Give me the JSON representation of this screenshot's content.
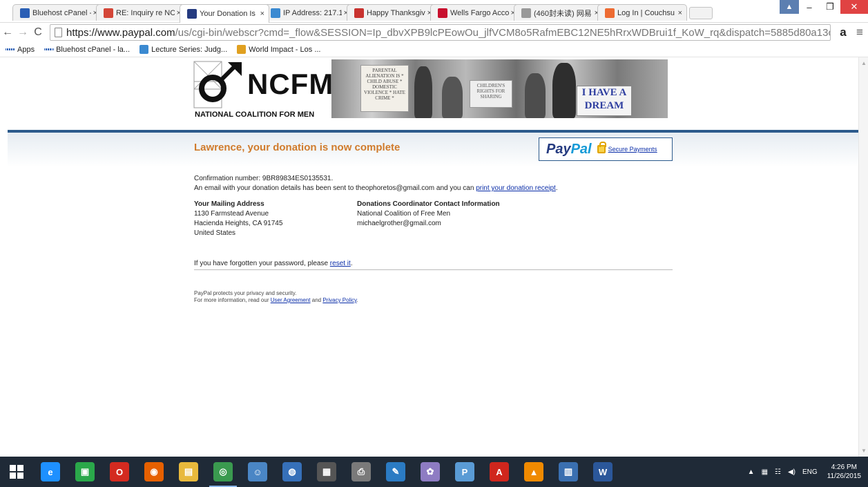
{
  "browser": {
    "tabs": [
      {
        "title": "Bluehost cPanel - ",
        "icon": "bluehost-grid-icon",
        "color": "#2b5fb5"
      },
      {
        "title": "RE: Inquiry re NCI",
        "icon": "gmail-icon",
        "color": "#d44638"
      },
      {
        "title": "Your Donation Is",
        "icon": "paypal-icon",
        "color": "#253b80",
        "active": true
      },
      {
        "title": "IP Address: 217.1",
        "icon": "globe-icon",
        "color": "#3b8ad1"
      },
      {
        "title": "Happy Thanksgiv",
        "icon": "wallet-icon",
        "color": "#c8322f"
      },
      {
        "title": "Wells Fargo Acco",
        "icon": "wells-fargo-icon",
        "color": "#c8102e"
      },
      {
        "title": "(460封未读) 网易",
        "icon": "page-icon",
        "color": "#999999"
      },
      {
        "title": "Log In | Couchsu",
        "icon": "couchsurfing-icon",
        "color": "#ed6b32"
      }
    ],
    "url_domain": "https://www.paypal.com",
    "url_path": "/us/cgi-bin/webscr?cmd=_flow&SESSION=Ip_dbvXPB9lcPEowOu_jlfVCM8o5RafmEBC12NE5hRrxWDBrui1f_KoW_rq&dispatch=5885d80a13c",
    "bookmarks": [
      {
        "label": "Apps",
        "icon": "apps-grid-icon"
      },
      {
        "label": "Bluehost cPanel - la...",
        "icon": "bluehost-grid-icon"
      },
      {
        "label": "Lecture Series: Judg...",
        "icon": "globe-icon"
      },
      {
        "label": "World Impact - Los ...",
        "icon": "world-impact-icon"
      }
    ]
  },
  "banner": {
    "logo_text": "NCFM",
    "logo_sub": "NATIONAL COALITION FOR MEN",
    "sign1": "PARENTAL ALIENATION IS * CHILD ABUSE * DOMESTIC VIOLENCE * HATE CRIME *",
    "sign2": "CHILDREN'S RIGHTS FOR SHARING",
    "sign3": "I HAVE A DREAM"
  },
  "page": {
    "headline": "Lawrence, your donation is now complete",
    "paypal_logo_a": "Pay",
    "paypal_logo_b": "Pal",
    "secure_link": "Secure Payments",
    "confirmation": "Confirmation number: 9BR89834ES0135531.",
    "email_line_prefix": "An email with your donation details has been sent to theophoretos@gmail.com and you can ",
    "receipt_link": "print your donation receipt",
    "email_line_suffix": ".",
    "mailing_heading": "Your Mailing Address",
    "mailing_lines": [
      "1130 Farmstead Avenue",
      "Hacienda Heights, CA 91745",
      "United States"
    ],
    "coordinator_heading": "Donations Coordinator Contact Information",
    "coordinator_lines": [
      "National Coalition of Free Men",
      "michaelgrother@gmail.com"
    ],
    "password_prefix": "If you have forgotten your password, please ",
    "reset_link": "reset it",
    "password_suffix": ".",
    "privacy_line1": "PayPal protects your privacy and security.",
    "privacy_prefix": "For more information, read our ",
    "user_agreement": "User Agreement",
    "and_text": " and ",
    "privacy_policy": "Privacy Policy",
    "privacy_suffix": "."
  },
  "taskbar": {
    "apps": [
      {
        "name": "internet-explorer-icon",
        "color": "#1e90ff",
        "glyph": "e"
      },
      {
        "name": "store-icon",
        "color": "#2aa84a",
        "glyph": "▣"
      },
      {
        "name": "opera-icon",
        "color": "#d42a20",
        "glyph": "O"
      },
      {
        "name": "firefox-icon",
        "color": "#e66000",
        "glyph": "◉"
      },
      {
        "name": "file-explorer-icon",
        "color": "#e8b93c",
        "glyph": "▤"
      },
      {
        "name": "chrome-icon",
        "color": "#3a9a4f",
        "glyph": "◎",
        "open": true
      },
      {
        "name": "people-icon",
        "color": "#4a86c5",
        "glyph": "☺"
      },
      {
        "name": "disc-icon",
        "color": "#3670b9",
        "glyph": "◍"
      },
      {
        "name": "dictionary-icon",
        "color": "#555555",
        "glyph": "▦"
      },
      {
        "name": "printer-icon",
        "color": "#7a7a7a",
        "glyph": "⎙"
      },
      {
        "name": "notes-icon",
        "color": "#2b7bc3",
        "glyph": "✎"
      },
      {
        "name": "paint-icon",
        "color": "#8e7cc3",
        "glyph": "✿"
      },
      {
        "name": "publisher-icon",
        "color": "#5a9bd5",
        "glyph": "P"
      },
      {
        "name": "acrobat-icon",
        "color": "#d0261d",
        "glyph": "A"
      },
      {
        "name": "vlc-icon",
        "color": "#f08a00",
        "glyph": "▲"
      },
      {
        "name": "document-icon",
        "color": "#3a6fb0",
        "glyph": "▥"
      },
      {
        "name": "word-icon",
        "color": "#2b579a",
        "glyph": "W"
      }
    ],
    "language": "ENG",
    "time": "4:26 PM",
    "date": "11/26/2015"
  }
}
